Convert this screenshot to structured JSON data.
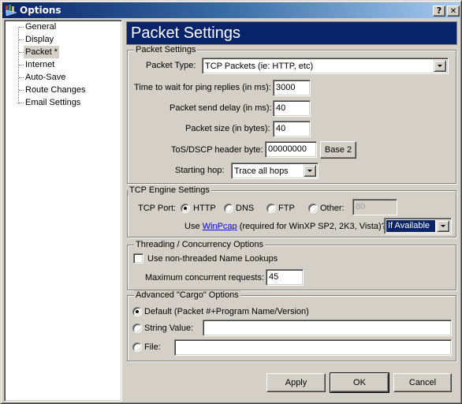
{
  "window": {
    "title": "Options",
    "help_button": "?",
    "close_button": "✕"
  },
  "sidebar": {
    "items": [
      {
        "label": "General",
        "selected": false
      },
      {
        "label": "Display",
        "selected": false
      },
      {
        "label": "Packet *",
        "selected": true
      },
      {
        "label": "Internet",
        "selected": false
      },
      {
        "label": "Auto-Save",
        "selected": false
      },
      {
        "label": "Route Changes",
        "selected": false
      },
      {
        "label": "Email Settings",
        "selected": false
      }
    ]
  },
  "page": {
    "title": "Packet Settings"
  },
  "packet_settings": {
    "legend": "Packet Settings",
    "packet_type_label": "Packet Type:",
    "packet_type_value": "TCP Packets (ie: HTTP, etc)",
    "ping_wait_label": "Time to wait for ping replies (in ms):",
    "ping_wait_value": "3000",
    "send_delay_label": "Packet send delay (in ms):",
    "send_delay_value": "40",
    "packet_size_label": "Packet size (in bytes):",
    "packet_size_value": "40",
    "tos_label": "ToS/DSCP header byte:",
    "tos_value": "00000000",
    "base_button": "Base 2",
    "starting_hop_label": "Starting hop:",
    "starting_hop_value": "Trace all hops"
  },
  "tcp_engine": {
    "legend": "TCP Engine Settings",
    "port_label": "TCP Port:",
    "options": [
      {
        "label": "HTTP",
        "checked": true
      },
      {
        "label": "DNS",
        "checked": false
      },
      {
        "label": "FTP",
        "checked": false
      },
      {
        "label": "Other:",
        "checked": false
      }
    ],
    "other_port_value": "80",
    "winpcap_prefix": "Use ",
    "winpcap_link": "WinPcap",
    "winpcap_suffix": " (required for WinXP SP2, 2K3, Vista)?",
    "winpcap_value": "If Available"
  },
  "threading": {
    "legend": "Threading / Concurrency Options",
    "non_threaded_label": "Use non-threaded Name Lookups",
    "non_threaded_checked": false,
    "max_requests_label": "Maximum concurrent requests:",
    "max_requests_value": "45"
  },
  "cargo": {
    "legend": "Advanced \"Cargo\" Options",
    "default_label": "Default (Packet #+Program Name/Version)",
    "string_label": "String Value:",
    "string_value": "",
    "file_label": "File:",
    "file_value": "",
    "selected": "default"
  },
  "buttons": {
    "apply": "Apply",
    "ok": "OK",
    "cancel": "Cancel"
  }
}
